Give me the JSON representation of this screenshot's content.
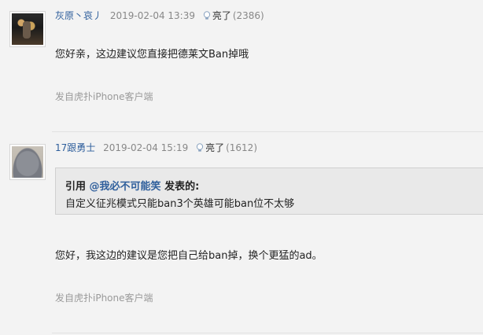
{
  "posts": [
    {
      "username": "灰原丶哀丿",
      "time": "2019-02-04 13:39",
      "light_label": "亮了",
      "light_count": "(2386)",
      "content": "您好亲，这边建议您直接把德莱文Ban掉哦",
      "source": "发自虎扑iPhone客户端"
    },
    {
      "username": "17跟勇士",
      "time": "2019-02-04 15:19",
      "light_label": "亮了",
      "light_count": "(1612)",
      "quote": {
        "prefix": "引用 ",
        "author": "@我必不可能笑",
        "suffix": " 发表的:",
        "body": "自定义征兆模式只能ban3个英雄可能ban位不太够"
      },
      "content": "您好，我这边的建议是您把自己给ban掉，换个更猛的ad。",
      "source": "发自虎扑iPhone客户端"
    }
  ],
  "icons": {
    "light": "lightbulb-icon"
  },
  "colors": {
    "username": "#2f5f9c",
    "meta": "#888888",
    "background": "#f3f3f3",
    "quote_bg": "#e9e9e9"
  }
}
